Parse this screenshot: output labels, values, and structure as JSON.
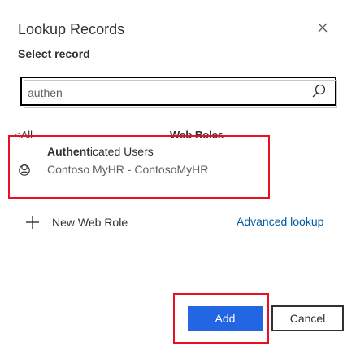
{
  "dialog": {
    "title": "Lookup Records",
    "subtitle": "Select record"
  },
  "search": {
    "value": "authen",
    "placeholder": ""
  },
  "results_header": {
    "back_label": "All",
    "back_arrow": "<",
    "entity_label": "Web Roles"
  },
  "result": {
    "name_match": "Authent",
    "name_rest": "icated Users",
    "subtitle": "Contoso MyHR - ContosoMyHR"
  },
  "actions": {
    "new_label": "New Web Role",
    "advanced_label": "Advanced lookup"
  },
  "footer": {
    "add_label": "Add",
    "cancel_label": "Cancel"
  },
  "colors": {
    "accent": "#2266e3",
    "highlight": "#e81123",
    "link": "#005a9e"
  },
  "icons": {
    "close": "close-icon",
    "search": "search-icon",
    "role": "role-icon",
    "plus": "plus-icon"
  }
}
